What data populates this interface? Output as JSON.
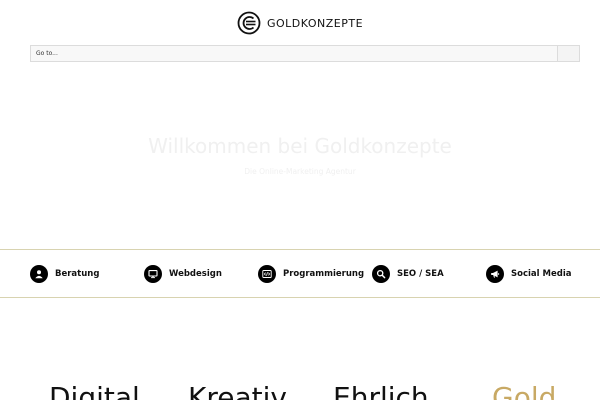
{
  "header": {
    "logo_text": "GOLDKONZEPTE"
  },
  "nav": {
    "select_label": "Go to..."
  },
  "hero": {
    "title": "Willkommen bei Goldkonzepte",
    "subtitle": "Die Online-Marketing Agentur"
  },
  "services": [
    {
      "label": "Beratung",
      "icon": "user-icon"
    },
    {
      "label": "Webdesign",
      "icon": "monitor-icon"
    },
    {
      "label": "Programmierung",
      "icon": "code-icon"
    },
    {
      "label": "SEO / SEA",
      "icon": "search-icon"
    },
    {
      "label": "Social Media",
      "icon": "megaphone-icon"
    }
  ],
  "values": [
    {
      "word": "Digital"
    },
    {
      "word": "Kreativ"
    },
    {
      "word": "Ehrlich"
    },
    {
      "word": "Gold"
    }
  ],
  "colors": {
    "accent_gold": "#c8a964",
    "divider": "#d8d3b0",
    "text": "#111111"
  }
}
